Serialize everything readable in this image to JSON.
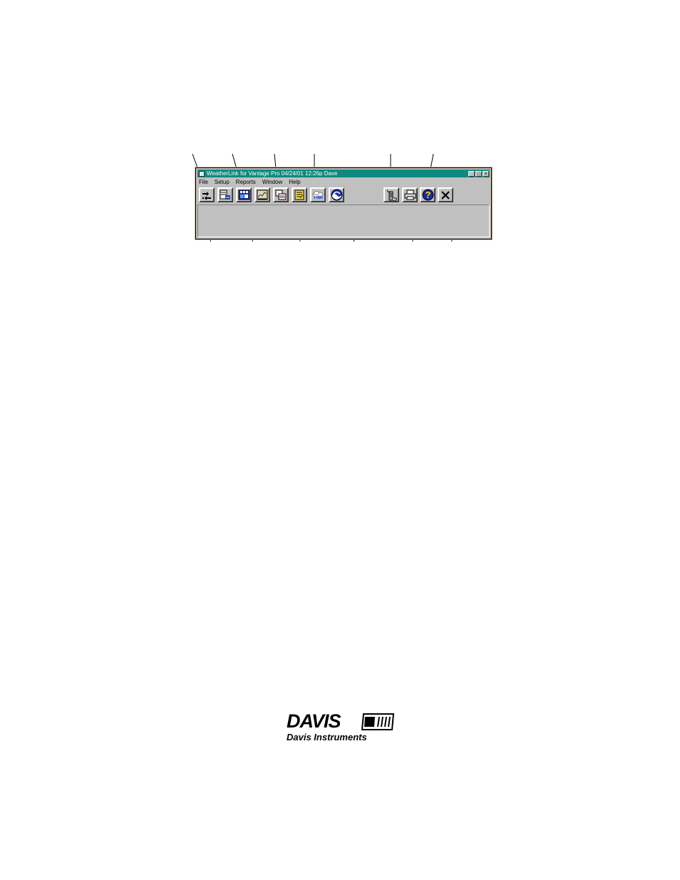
{
  "window": {
    "title": "WeatherLink for Vantage Pro  04/24/01  12:26p  Dave",
    "controls": {
      "minimize": "_",
      "maximize": "□",
      "close": "×"
    }
  },
  "menu": [
    "File",
    "Setup",
    "Reports",
    "Window",
    "Help"
  ],
  "toolbar": [
    {
      "name": "select-station-button",
      "icon": "station-arrows-icon"
    },
    {
      "name": "summary-button",
      "icon": "summary-grid-icon"
    },
    {
      "name": "bulletin-button",
      "icon": "bulletin-icon"
    },
    {
      "name": "graph-button",
      "icon": "graph-icon"
    },
    {
      "name": "browse-button",
      "icon": "browse-window-icon"
    },
    {
      "name": "notes-button",
      "icon": "notes-icon"
    },
    {
      "name": "weather-cloud-button",
      "icon": "cloud-icon"
    },
    {
      "name": "noaa-button",
      "icon": "noaa-emblem-icon"
    },
    {
      "name": "download-button",
      "icon": "download-icon"
    },
    {
      "name": "print-button",
      "icon": "printer-icon"
    },
    {
      "name": "help-button",
      "icon": "help-icon"
    },
    {
      "name": "exit-button",
      "icon": "close-x-icon"
    }
  ],
  "logo": {
    "word": "DAVIS",
    "subtitle": "Davis Instruments"
  }
}
